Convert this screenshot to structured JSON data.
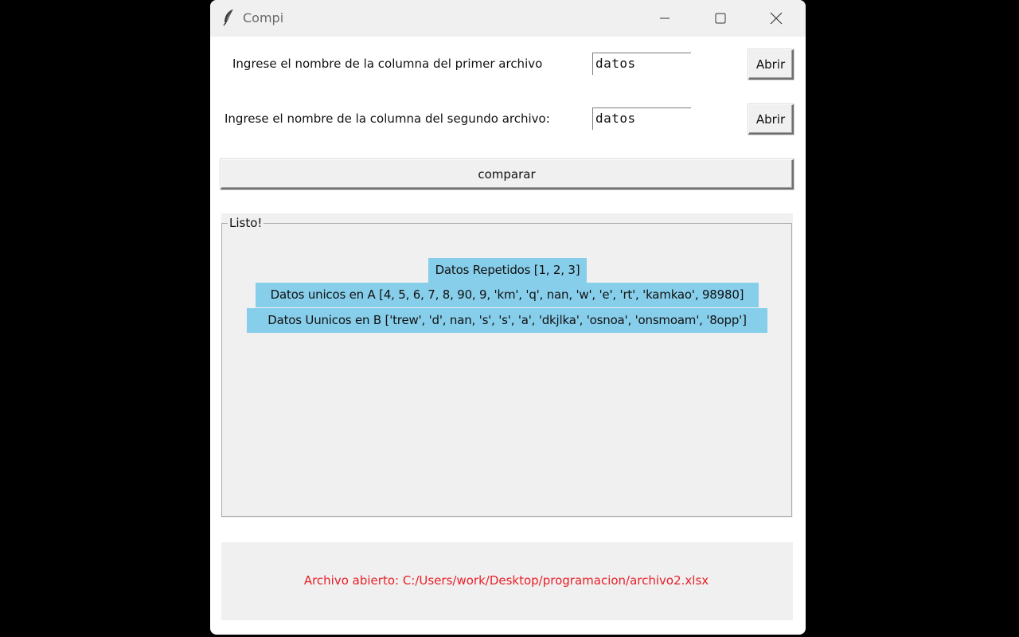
{
  "window": {
    "title": "Compi",
    "icons": {
      "app": "feather-icon",
      "minimize": "minimize-icon",
      "maximize": "maximize-icon",
      "close": "close-icon"
    }
  },
  "form": {
    "row1": {
      "label": "Ingrese el nombre de la columna del primer archivo",
      "value": "datos",
      "button": "Abrir"
    },
    "row2": {
      "label": "Ingrese el nombre de la columna del segundo archivo:",
      "value": "datos",
      "button": "Abrir"
    },
    "compare_button": "comparar"
  },
  "results": {
    "legend": "Listo!",
    "highlight_color": "#87ceeb",
    "lines": [
      "Datos Repetidos [1, 2, 3]",
      "Datos unicos en A [4, 5, 6, 7, 8, 90, 9, 'km', 'q', nan, 'w', 'e', 'rt', 'kamkao', 98980]",
      "Datos Uunicos en B ['trew', 'd', nan, 's', 's', 'a', 'dkjlka', 'osnoa', 'onsmoam', '8opp']"
    ]
  },
  "status": {
    "text": "Archivo abierto: C:/Users/work/Desktop/programacion/archivo2.xlsx",
    "color": "#e8202a"
  }
}
